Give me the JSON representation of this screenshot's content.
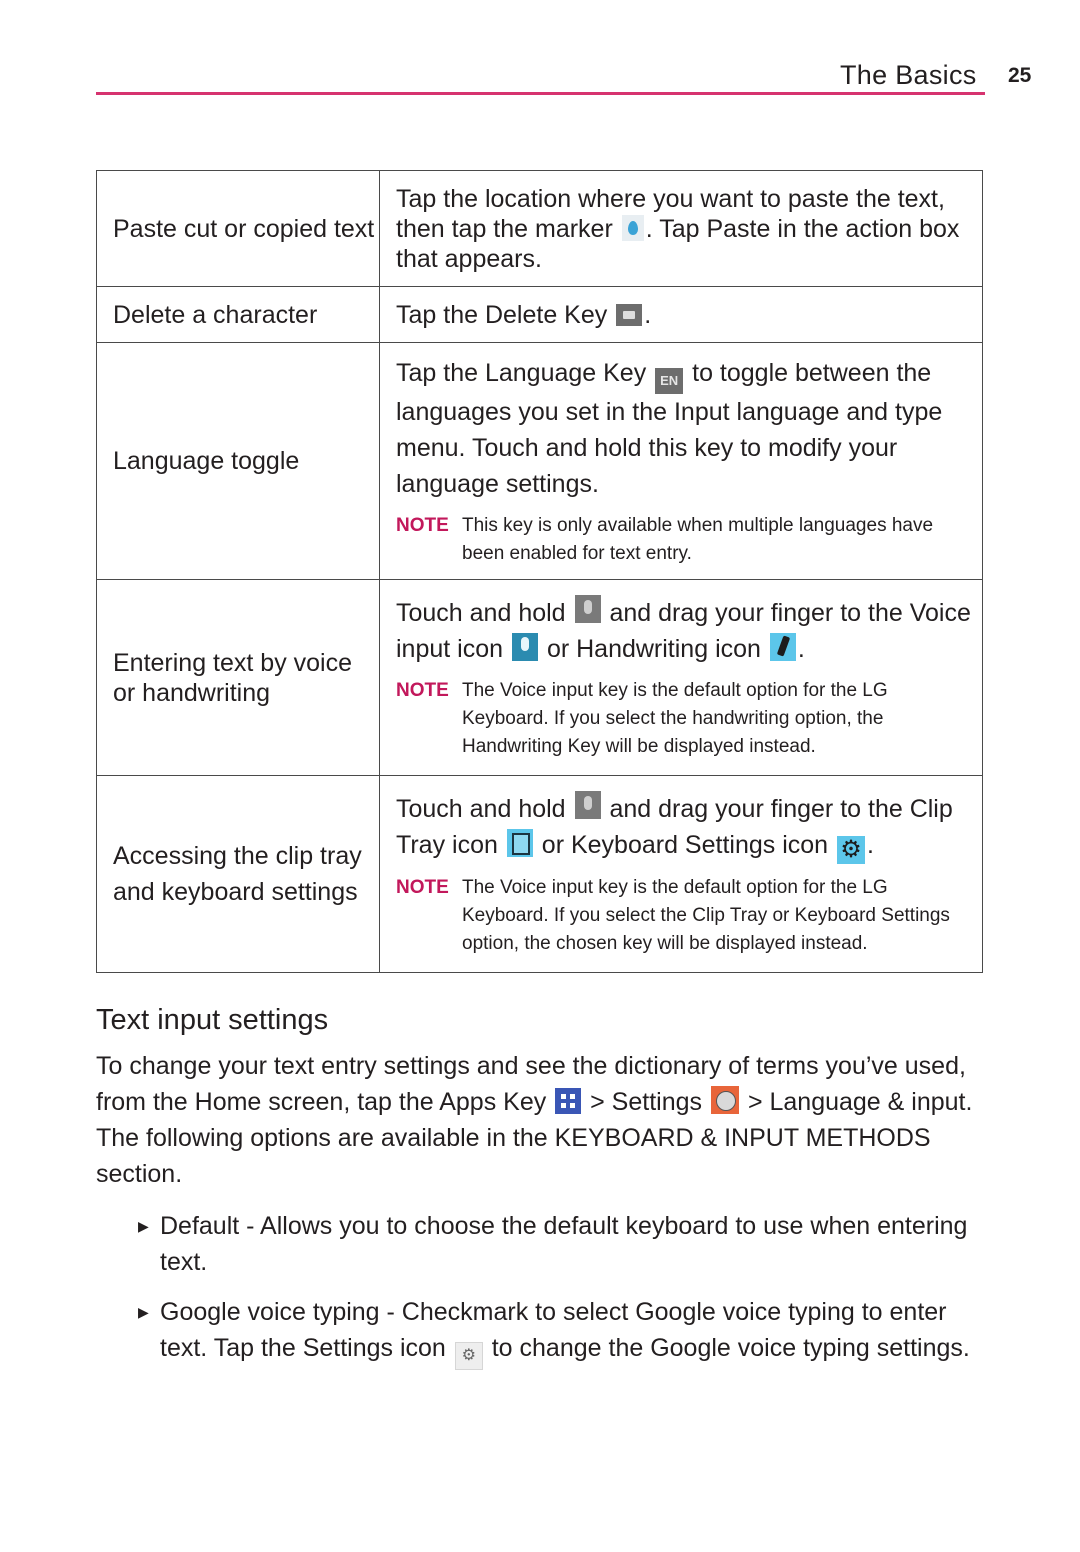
{
  "header": {
    "section_title": "The Basics",
    "page_number": "25",
    "accent_color": "#d6336f"
  },
  "table": {
    "rows": [
      {
        "feature": "Paste cut or copied text",
        "main_parts": [
          "Tap the location where you want to paste the text, then tap the marker",
          ". Tap Paste in the action box that appears."
        ],
        "icons": [
          "marker-icon"
        ]
      },
      {
        "feature": "Delete a character",
        "main_parts": [
          "Tap the Delete Key",
          "."
        ],
        "icons": [
          "delete-key-icon"
        ]
      },
      {
        "feature": "Language toggle",
        "main_parts": [
          "Tap the Language Key",
          "to toggle between the languages you set in the Input language and type menu. Touch and hold this key to modify your language settings."
        ],
        "icons": [
          "language-key-icon"
        ],
        "icon_text": "EN",
        "note_label": "NOTE",
        "note": "This key is only available when multiple languages have been enabled for text entry."
      },
      {
        "feature": "Entering text by voice or handwriting",
        "main_parts": [
          "Touch and hold",
          "and drag your finger to the Voice input icon",
          "or Handwriting icon",
          "."
        ],
        "icons": [
          "multi-function-key-icon",
          "voice-input-icon",
          "handwriting-icon"
        ],
        "note_label": "NOTE",
        "note": "The Voice input key is the default option for the LG Keyboard. If you select the handwriting option, the Handwriting Key will be displayed instead."
      },
      {
        "feature": "Accessing the clip tray and keyboard settings",
        "main_parts": [
          "Touch and hold",
          "and drag your finger to the Clip Tray icon",
          "or Keyboard Settings icon",
          "."
        ],
        "icons": [
          "multi-function-key-icon",
          "clip-tray-icon",
          "keyboard-settings-icon"
        ],
        "note_label": "NOTE",
        "note": "The Voice input key is the default option for the LG Keyboard. If you select the Clip Tray or Keyboard Settings option, the chosen key will be displayed instead."
      }
    ]
  },
  "section": {
    "title": "Text input settings",
    "intro_parts": [
      "To change your text entry settings and see the dictionary of terms you’ve used, from the Home screen, tap the Apps Key",
      "> Settings",
      "> Language & input. The following options are available in the KEYBOARD & INPUT METHODS section."
    ],
    "bullets": [
      {
        "parts": [
          "Default - Allows you to choose the default keyboard to use when entering text."
        ]
      },
      {
        "parts": [
          "Google voice typing - Checkmark to select Google voice typing to enter text. Tap the Settings icon",
          "to change the Google voice typing settings."
        ]
      }
    ]
  }
}
